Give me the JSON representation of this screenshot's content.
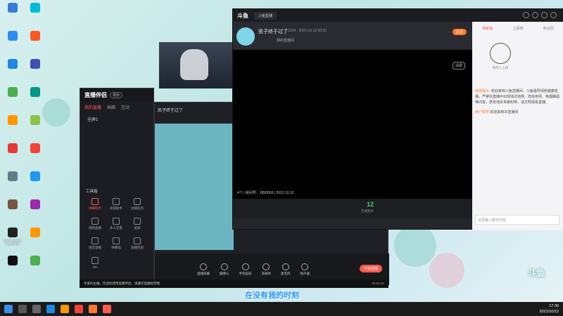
{
  "desktop": {
    "icons": [
      {
        "label": "",
        "color": "#3a7bd5"
      },
      {
        "label": "",
        "color": "#2d8cf0"
      },
      {
        "label": "",
        "color": "#1e88e5"
      },
      {
        "label": "",
        "color": "#4caf50"
      },
      {
        "label": "",
        "color": "#ff9800"
      },
      {
        "label": "",
        "color": "#e53935"
      },
      {
        "label": "",
        "color": "#607d8b"
      },
      {
        "label": "",
        "color": "#795548"
      },
      {
        "label": "Epic Games Launcher",
        "color": "#222"
      },
      {
        "label": "",
        "color": "#111"
      },
      {
        "label": "",
        "color": "#00bcd4"
      },
      {
        "label": "",
        "color": "#ff5722"
      },
      {
        "label": "",
        "color": "#3f51b5"
      },
      {
        "label": "",
        "color": "#009688"
      },
      {
        "label": "",
        "color": "#8bc34a"
      },
      {
        "label": "",
        "color": "#f44336"
      },
      {
        "label": "",
        "color": "#2196f3"
      },
      {
        "label": "",
        "color": "#9c27b0"
      },
      {
        "label": "",
        "color": "#ff9800"
      },
      {
        "label": "",
        "color": "#4caf50"
      }
    ]
  },
  "obs": {
    "logo": "直播伴侣",
    "tag": "模板",
    "tabs": [
      "我的直播",
      "画面",
      "互动"
    ],
    "scene": "全屏1",
    "tools_title": "工具箱",
    "tools": [
      "弹幕助手",
      "房管助手",
      "主播任务",
      "视频直播",
      "多人连麦",
      "录屏",
      "语音直播",
      "弹幕墙",
      "直播回放",
      "PK",
      "",
      ""
    ],
    "main_title": "凯子终于过了",
    "bottom": [
      "直播屏幕",
      "摄像头",
      "手机投屏",
      "多媒体",
      "麦克风",
      "扬声器"
    ],
    "start_live": "开始直播",
    "notice": "亲爱的主播，欢迎您使用直播伴侣，请遵守直播规范哦",
    "notice_time": "00:00:00"
  },
  "browser": {
    "tab_title": "斗鱼直播",
    "room_title": "凯子终于过了",
    "room_id": "2224",
    "room_time": "2021-10-12 00:53",
    "room_sub": "我的直播间",
    "follow": "关注",
    "clear": "清屏",
    "status": "4个 | 房间号：1850503 | 2021.10.12",
    "gift_count": "12",
    "gift_label": "在线观众",
    "side_tabs": [
      "贡献值",
      "土豪榜",
      "粉丝团"
    ],
    "fan_label": "暂无人上榜",
    "chat_sys": "系统提示:",
    "chat_text": "欢迎来到斗鱼直播间，斗鱼倡导绿色健康直播，严禁在直播中出现违法违规、低俗色情、吸烟酗酒等内容，若有违反将被封停，请文明观看直播。",
    "chat_name": "用户昵称",
    "chat_welcome": "欢迎来到本直播间",
    "chat_placeholder": "这里输入聊天内容"
  },
  "overlay": {
    "brand": "斗鱼",
    "subtitle": "在没有我的时刻"
  },
  "taskbar": {
    "time": "17:39",
    "date": "2021/10/12"
  }
}
